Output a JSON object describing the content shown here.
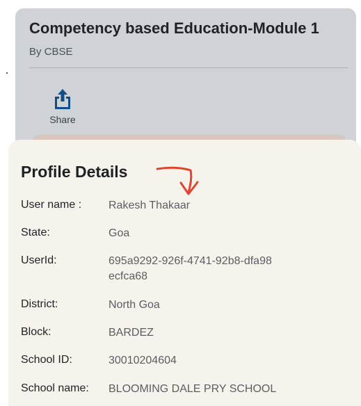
{
  "course": {
    "title": "Competency based Education-Module 1",
    "by": "By CBSE",
    "share_label": "Share"
  },
  "profile": {
    "title": "Profile Details",
    "rows": [
      {
        "label": "User name :",
        "value": "Rakesh Thakaar"
      },
      {
        "label": "State:",
        "value": "Goa"
      },
      {
        "label": "UserId:",
        "value": "695a9292-926f-4741-92b8-dfa98ecfca68"
      },
      {
        "label": "District:",
        "value": "North Goa"
      },
      {
        "label": "Block:",
        "value": "BARDEZ"
      },
      {
        "label": "School ID:",
        "value": "30010204604"
      },
      {
        "label": "School name:",
        "value": "BLOOMING DALE PRY SCHOOL"
      }
    ]
  },
  "colors": {
    "share_icon": "#0f4e8a",
    "annotation_arrow": "#e0442e"
  },
  "icons": {
    "share": "share-icon",
    "annotation": "red-arrow-annotation"
  }
}
